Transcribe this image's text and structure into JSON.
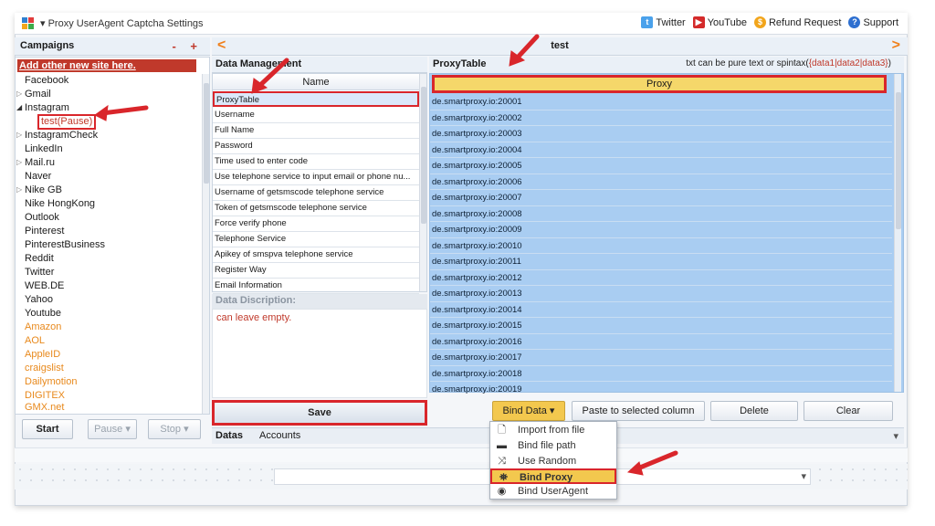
{
  "window": {
    "title": "▾  Proxy  UserAgent  Captcha  Settings",
    "links": [
      {
        "label": "Twitter",
        "icon": "twitter-icon"
      },
      {
        "label": "YouTube",
        "icon": "youtube-icon"
      },
      {
        "label": "Refund Request",
        "icon": "refund-icon"
      },
      {
        "label": "Support",
        "icon": "support-icon"
      }
    ]
  },
  "campaigns": {
    "header": "Campaigns",
    "controls": "- +",
    "add_link": "Add other new site here.",
    "items": [
      "Facebook",
      "Gmail",
      "Instagram",
      "test(Pause)",
      "InstagramCheck",
      "LinkedIn",
      "Mail.ru",
      "Naver",
      "Nike GB",
      "Nike HongKong",
      "Outlook",
      "Pinterest",
      "PinterestBusiness",
      "Reddit",
      "Twitter",
      "WEB.DE",
      "Yahoo",
      "Youtube",
      "Amazon",
      "AOL",
      "AppleID",
      "craigslist",
      "Dailymotion",
      "DIGITEX",
      "GMX.net"
    ],
    "buttons": {
      "start": "Start",
      "pause": "Pause",
      "stop": "Stop"
    }
  },
  "nav": {
    "prev": "<",
    "next": ">",
    "title": "test"
  },
  "data_management": {
    "header": "Data Management",
    "column": "Name",
    "rows": [
      "ProxyTable",
      "Username",
      "Full Name",
      "Password",
      "Time used to enter code",
      "Use telephone service to input email or phone nu...",
      "Username of getsmscode telephone service",
      "Token of getsmscode telephone service",
      "Force verify phone",
      "Telephone Service",
      "Apikey of smspva telephone service",
      "Register Way",
      "Email Information"
    ],
    "description_header": "Data Discription:",
    "description": "can leave empty.",
    "save": "Save"
  },
  "proxy_table": {
    "title": "ProxyTable",
    "hint_prefix": "txt can be pure text or spintax(",
    "hint_spintax": "{data1|data2|data3}",
    "hint_suffix": ")",
    "column": "Proxy",
    "rows": [
      "de.smartproxy.io:20001",
      "de.smartproxy.io:20002",
      "de.smartproxy.io:20003",
      "de.smartproxy.io:20004",
      "de.smartproxy.io:20005",
      "de.smartproxy.io:20006",
      "de.smartproxy.io:20007",
      "de.smartproxy.io:20008",
      "de.smartproxy.io:20009",
      "de.smartproxy.io:20010",
      "de.smartproxy.io:20011",
      "de.smartproxy.io:20012",
      "de.smartproxy.io:20013",
      "de.smartproxy.io:20014",
      "de.smartproxy.io:20015",
      "de.smartproxy.io:20016",
      "de.smartproxy.io:20017",
      "de.smartproxy.io:20018",
      "de.smartproxy.io:20019"
    ]
  },
  "actions": {
    "bind_data": "Bind Data",
    "paste": "Paste to selected column",
    "delete": "Delete",
    "clear": "Clear"
  },
  "bind_menu": [
    {
      "label": "Import from file",
      "icon": "file-icon"
    },
    {
      "label": "Bind file path",
      "icon": "folder-icon"
    },
    {
      "label": "Use Random",
      "icon": "shuffle-icon"
    },
    {
      "label": "Bind Proxy",
      "icon": "network-icon"
    },
    {
      "label": "Bind UserAgent",
      "icon": "globe-icon"
    }
  ],
  "tabs": [
    "Datas",
    "Accounts"
  ],
  "colors": {
    "accent_red": "#d9262b",
    "orange": "#f07f1a",
    "highlight_yellow": "#f5d76a",
    "table_blue": "#a9cdf2"
  }
}
